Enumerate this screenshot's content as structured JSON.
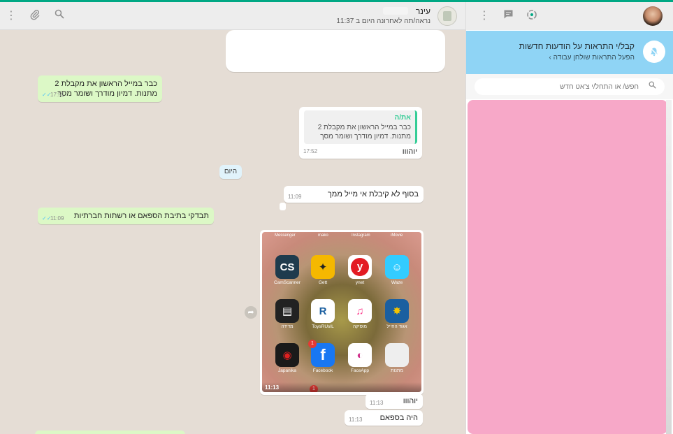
{
  "header": {
    "contact_name": "עינר",
    "contact_status": "נראה/תה לאחרונה היום ב 11:37"
  },
  "icons": {
    "menu": "menu-dots-icon",
    "attach": "paperclip-icon",
    "search": "search-icon",
    "chat": "new-chat-icon",
    "status": "status-ring-icon",
    "bell": "bell-muted-icon",
    "forward": "forward-icon"
  },
  "messages": [
    {
      "dir": "out",
      "text": "כבר במייל הראשון את מקבלת 2 מתנות. דמיון מודרך ושומר מסך",
      "time": "17:51"
    },
    {
      "dir": "in",
      "quote_author": "את/ה",
      "quote_text": "כבר במייל הראשון את מקבלת 2 מתנות. דמיון מודרך ושומר מסך",
      "text": "יוהווו",
      "time": "17:52"
    },
    {
      "dir": "in",
      "text": "בסוף לא קיבלת אי מייל ממך",
      "time": "11:09"
    },
    {
      "dir": "out",
      "text": "תבדקי בתיבת הספאם או רשתות חברתיות",
      "time": "11:09"
    },
    {
      "dir": "in",
      "text": "יוהווו",
      "time": "11:13"
    },
    {
      "dir": "in",
      "text": "היה בספאם",
      "time": "11:13"
    }
  ],
  "day_divider": "היום",
  "phone": {
    "time": "11:13",
    "top_row": [
      "Messenger",
      "mako",
      "Instagram",
      "iMovie"
    ],
    "apps": [
      {
        "label": "CamScanner",
        "glyph": "CS",
        "color": "#1f3b4d"
      },
      {
        "label": "Gett",
        "glyph": "✦",
        "color": "#f5b800"
      },
      {
        "label": "ynet",
        "glyph": "y",
        "color": "#e31b23"
      },
      {
        "label": "Waze",
        "glyph": "☺",
        "color": "#33ccff"
      },
      {
        "label": "מדידה",
        "glyph": "▤",
        "color": "#222222"
      },
      {
        "label": "ToysRUsIL",
        "glyph": "R",
        "color": "#ffffff"
      },
      {
        "label": "מוסיקה",
        "glyph": "♫",
        "color": "#ffffff"
      },
      {
        "label": "אגוד החייל",
        "glyph": "✸",
        "color": "#1a5fa0"
      },
      {
        "label": "Japanika",
        "glyph": "◉",
        "color": "#1a1a1a"
      },
      {
        "label": "Facebook",
        "glyph": "f",
        "color": "#1877f2",
        "badge": "1"
      },
      {
        "label": "FaceApp",
        "glyph": "◐",
        "color": "#ffffff"
      },
      {
        "label": "מתנות",
        "glyph": "",
        "color": "#eeeeee"
      }
    ],
    "bottom_badge": "1"
  },
  "sidebar": {
    "notif_title": "קבל/י התראות על הודעות חדשות",
    "notif_sub": "הפעל התראות שולחן עבודה ›",
    "search_placeholder": "חפש/ או התחל/י צ'אט חדש"
  }
}
